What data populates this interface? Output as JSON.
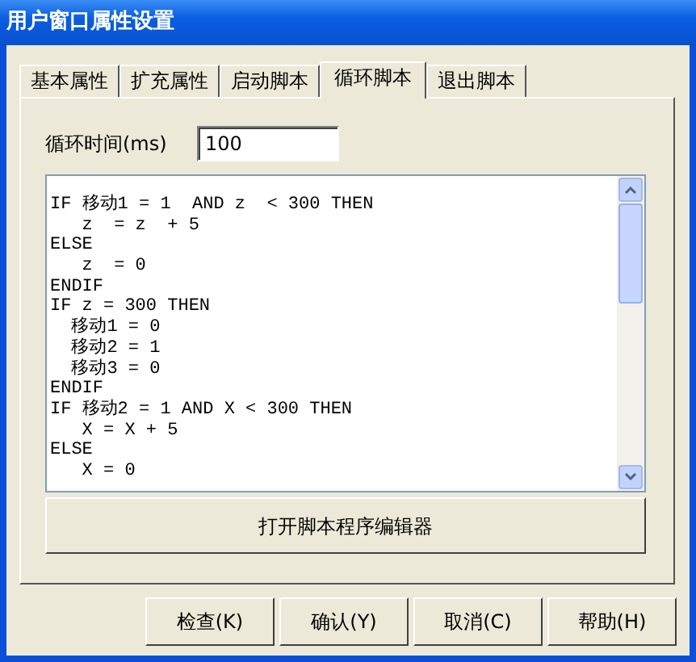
{
  "window": {
    "title": "用户窗口属性设置"
  },
  "tabs": [
    {
      "label": "基本属性",
      "selected": false
    },
    {
      "label": "扩充属性",
      "selected": false
    },
    {
      "label": "启动脚本",
      "selected": false
    },
    {
      "label": "循环脚本",
      "selected": true
    },
    {
      "label": "退出脚本",
      "selected": false
    }
  ],
  "cycle_time": {
    "label": "循环时间(ms)",
    "value": "100"
  },
  "script_lines": [
    "IF 移动1 = 1  AND z  < 300 THEN",
    "   z  = z  + 5",
    "ELSE",
    "   z  = 0",
    "ENDIF",
    "IF z = 300 THEN",
    "  移动1 = 0",
    "  移动2 = 1",
    "  移动3 = 0",
    "ENDIF",
    "IF 移动2 = 1 AND X < 300 THEN",
    "   X = X + 5",
    "ELSE",
    "   X = 0"
  ],
  "editor_button": "打开脚本程序编辑器",
  "buttons": [
    "检查(K)",
    "确认(Y)",
    "取消(C)",
    "帮助(H)"
  ]
}
